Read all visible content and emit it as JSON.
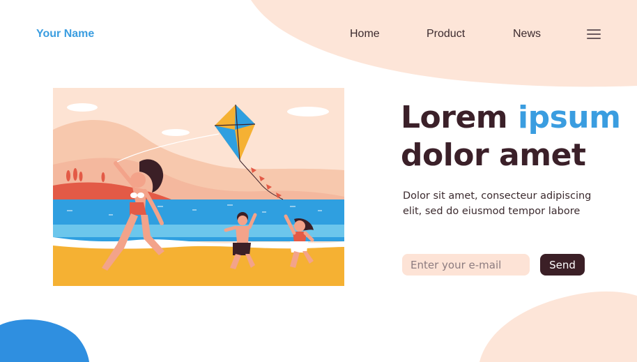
{
  "brand": {
    "name": "Your Name"
  },
  "nav": {
    "items": [
      {
        "label": "Home"
      },
      {
        "label": "Product"
      },
      {
        "label": "News"
      }
    ],
    "menu_icon": "hamburger-menu-icon"
  },
  "hero": {
    "headline_part1": "Lorem ",
    "headline_accent": "ipsum",
    "headline_line2": "dolor amet",
    "subtext": "Dolor sit amet, consecteur adipiscing elit, sed do eiusmod tempor labore",
    "illustration": "family flying a kite on the beach"
  },
  "signup": {
    "email_placeholder": "Enter your e-mail",
    "send_label": "Send"
  },
  "colors": {
    "accent": "#3a9de0",
    "dark": "#3b1f26",
    "peach": "#fde3d6",
    "sand": "#f5b133",
    "sea": "#2f9fe0"
  }
}
